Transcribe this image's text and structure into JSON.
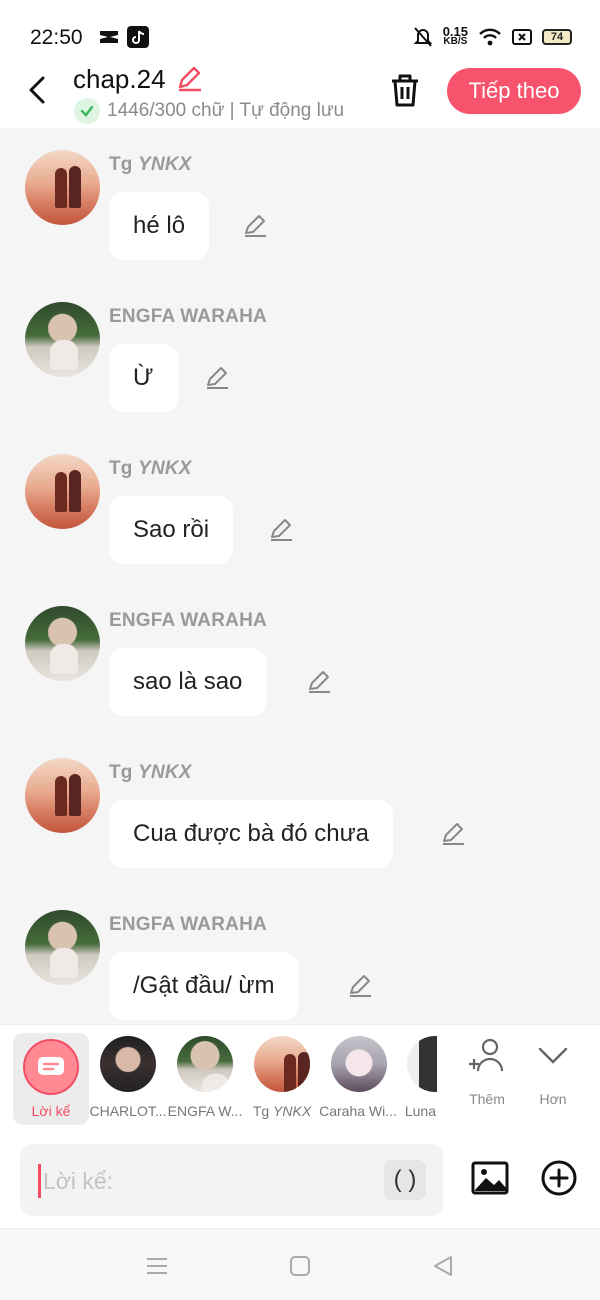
{
  "status_bar": {
    "time": "22:50",
    "network_speed_value": "0.15",
    "network_speed_unit": "KB/S",
    "battery": "74",
    "icons": [
      "capcut-icon",
      "tiktok-icon",
      "mute-bell-icon",
      "wifi-icon",
      "sim-icon",
      "battery-icon"
    ]
  },
  "header": {
    "title": "chap.24",
    "saved_status": "1446/300 chữ | Tự động lưu",
    "next_label": "Tiếp theo",
    "accent_color": "#f7536c"
  },
  "messages": [
    {
      "sender_prefix": "Tg ",
      "sender_name": "YNKX",
      "text": "hé lô",
      "avatar": "sunset"
    },
    {
      "sender_prefix": "",
      "sender_name": "ENGFA WARAHA",
      "text": "Ừ",
      "avatar": "girl"
    },
    {
      "sender_prefix": "Tg ",
      "sender_name": "YNKX",
      "text": "Sao rồi",
      "avatar": "sunset"
    },
    {
      "sender_prefix": "",
      "sender_name": "ENGFA WARAHA",
      "text": "sao là sao",
      "avatar": "girl"
    },
    {
      "sender_prefix": "Tg ",
      "sender_name": "YNKX",
      "text": "Cua được bà đó chưa",
      "avatar": "sunset"
    },
    {
      "sender_prefix": "",
      "sender_name": "ENGFA WARAHA",
      "text": "/Gật đầu/ ừm",
      "avatar": "girl"
    }
  ],
  "picker": {
    "narrator_label": "Lời kể",
    "characters": [
      {
        "label": "CHARLOT...",
        "avatar": "dark"
      },
      {
        "label": "ENGFA W...",
        "avatar": "girl"
      },
      {
        "label_prefix": "Tg ",
        "label": "YNKX",
        "avatar": "sunset"
      },
      {
        "label": "Caraha Wi...",
        "avatar": "anime"
      },
      {
        "label": "Luna",
        "avatar": "partial"
      }
    ],
    "add_label": "Thêm",
    "more_label": "Hơn"
  },
  "input": {
    "placeholder": "Lời kể:",
    "value": "",
    "paren_label": "( )"
  }
}
